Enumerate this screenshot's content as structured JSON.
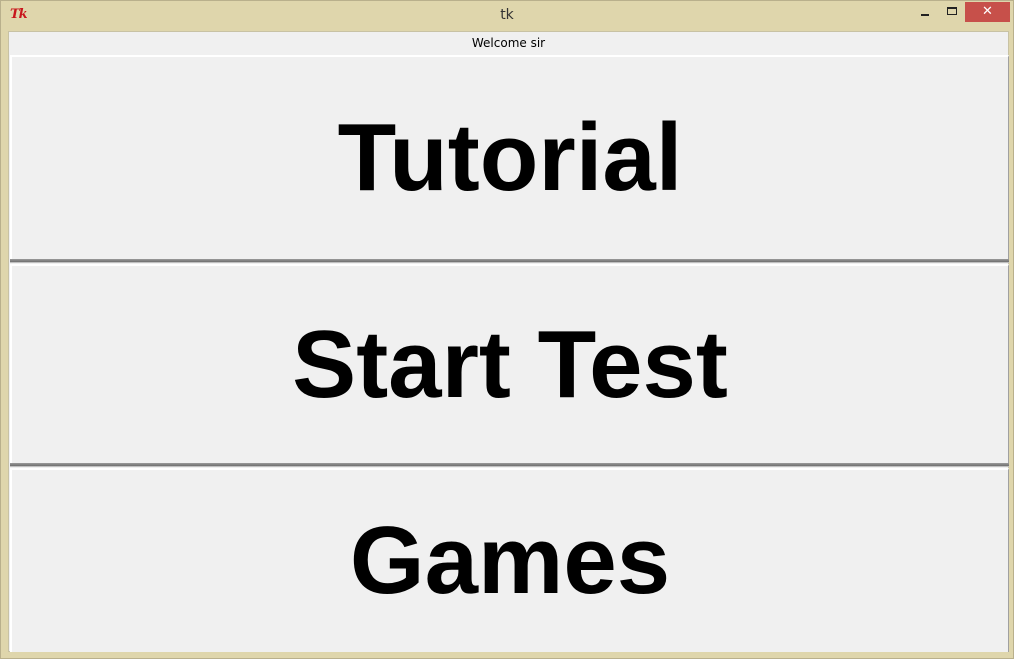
{
  "window": {
    "title": "tk",
    "app_icon_text": "Tk",
    "close_glyph": "✕"
  },
  "header": {
    "welcome_text": "Welcome sir"
  },
  "buttons": [
    {
      "label": "Tutorial"
    },
    {
      "label": "Start Test"
    },
    {
      "label": "Games"
    }
  ]
}
